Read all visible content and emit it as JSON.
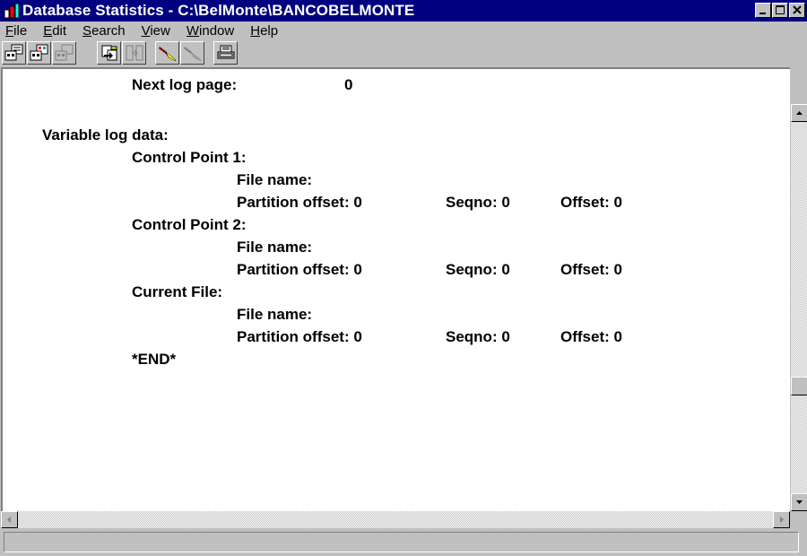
{
  "window": {
    "title": "Database Statistics - C:\\BelMonte\\BANCOBELMONTE",
    "controls": [
      "minimize-icon",
      "maximize-icon",
      "close-icon"
    ]
  },
  "menu": [
    {
      "label": "File",
      "accel": "F",
      "rest": "ile"
    },
    {
      "label": "Edit",
      "accel": "E",
      "rest": "dit"
    },
    {
      "label": "Search",
      "accel": "S",
      "rest": "earch"
    },
    {
      "label": "View",
      "accel": "V",
      "rest": "iew"
    },
    {
      "label": "Window",
      "accel": "W",
      "rest": "indow"
    },
    {
      "label": "Help",
      "accel": "H",
      "rest": "elp"
    }
  ],
  "toolbar": {
    "buttons": [
      "open-database-icon",
      "open-file-icon",
      "close-database-icon",
      "copy-icon",
      "split-icon",
      "highlight-icon",
      "highlight-disabled-icon",
      "print-icon"
    ]
  },
  "document": {
    "lines": [
      {
        "label": "Next log page:",
        "value": "0"
      },
      {
        "text": "Variable log data:"
      },
      {
        "text": "Control Point 1:"
      },
      {
        "text": "File name:"
      },
      {
        "partition": "Partition offset: 0",
        "seqno": "Seqno: 0",
        "offset": "Offset: 0"
      },
      {
        "text": "Control Point 2:"
      },
      {
        "text": "File name:"
      },
      {
        "partition": "Partition offset: 0",
        "seqno": "Seqno: 0",
        "offset": "Offset: 0"
      },
      {
        "text": "Current File:"
      },
      {
        "text": "File name:"
      },
      {
        "partition": "Partition offset: 0",
        "seqno": "Seqno: 0",
        "offset": "Offset: 0"
      },
      {
        "text": "*END*"
      }
    ]
  },
  "statusbar": {
    "text": ""
  },
  "colors": {
    "titlebar": "#000080",
    "face": "#c0c0c0",
    "client": "#ffffff"
  }
}
